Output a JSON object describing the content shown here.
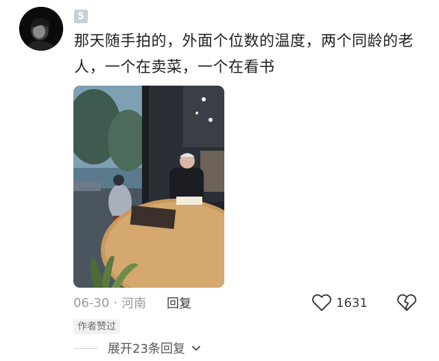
{
  "comment": {
    "level": "5",
    "text": "那天随手拍的，外面个位数的温度，两个同龄的老人，一个在卖菜，一个在看书",
    "date": "06-30",
    "separator": "·",
    "location": "河南",
    "reply_label": "回复",
    "like_count": "1631",
    "author_liked": "作者赞过",
    "expand_replies": "展开23条回复"
  },
  "icons": {
    "like": "heart-outline-icon",
    "dislike": "broken-heart-icon",
    "expand": "chevron-down-icon"
  },
  "colors": {
    "text": "#1f1f1f",
    "meta": "#9a9a9a",
    "badge": "#c9ced6",
    "tag_bg": "#f0f1f3"
  }
}
